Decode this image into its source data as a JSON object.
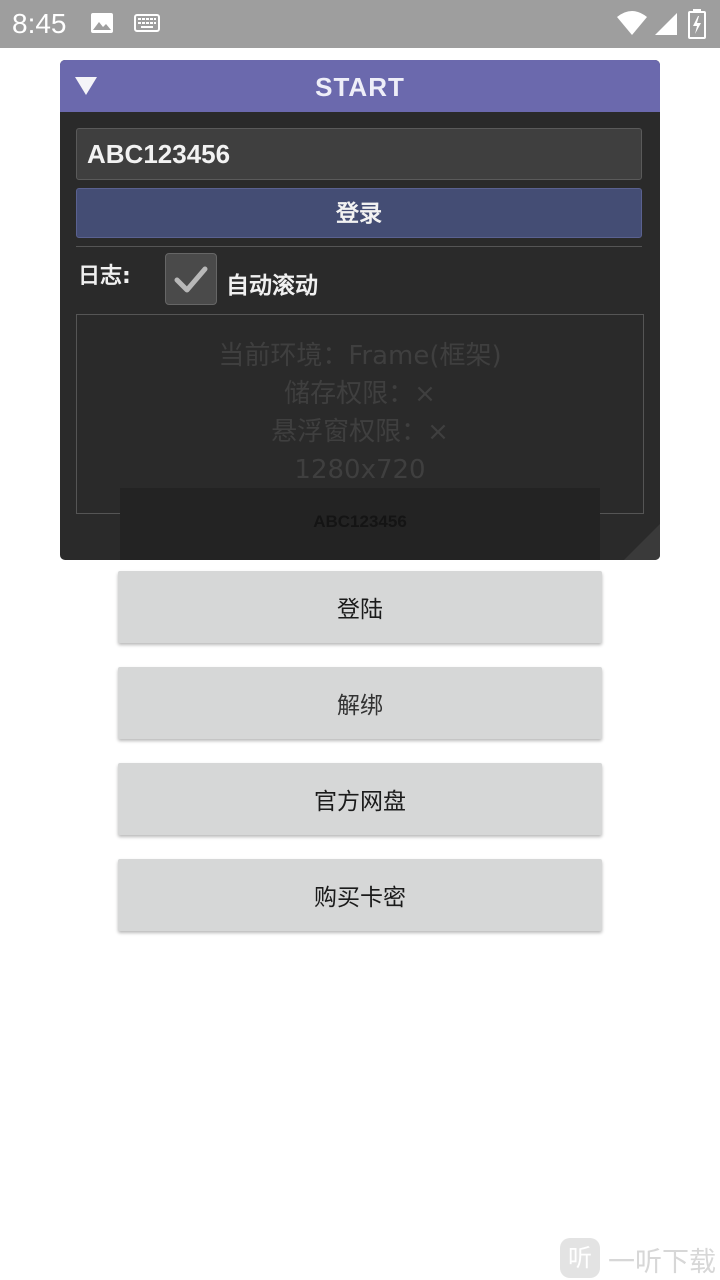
{
  "status_bar": {
    "time": "8:45",
    "icons": [
      "image-icon",
      "keyboard-icon",
      "wifi-icon",
      "signal-icon",
      "battery-icon"
    ]
  },
  "panel": {
    "title": "START",
    "key_value": "ABC123456",
    "login_label": "登录",
    "log_label": "日志:",
    "autoscroll_label": "自动滚动",
    "autoscroll_checked": true,
    "log_lines": [
      "当前环境：Frame(框架)",
      "储存权限：×",
      "悬浮窗权限：×",
      "1280x720"
    ],
    "overlay_text": "ABC123456"
  },
  "page_buttons": {
    "login": "登陆",
    "unbind": "解绑",
    "netdisk": "官方网盘",
    "buy_card": "购买卡密"
  },
  "watermark": {
    "icon_char": "听",
    "text": "一听下载"
  },
  "colors": {
    "header": "#6b69ad",
    "panel_bg": "#2a2a2a",
    "login_button": "#444d74",
    "page_button": "#d6d7d7",
    "status_bar": "#9e9e9e"
  }
}
